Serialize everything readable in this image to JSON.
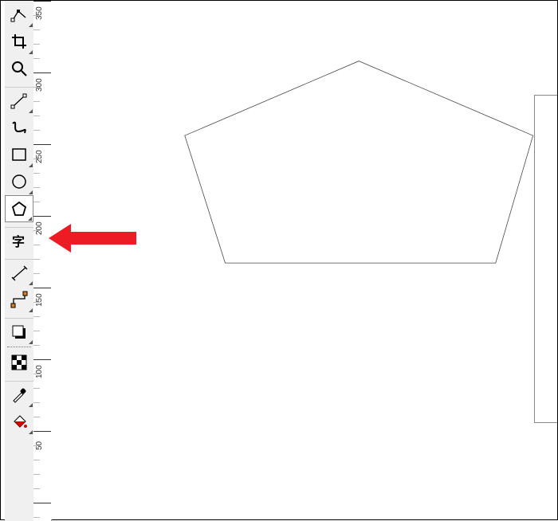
{
  "ruler": {
    "labels": [
      "350",
      "300",
      "250",
      "200",
      "150",
      "100",
      "50"
    ]
  },
  "tools": [
    {
      "name": "edit-nodes-tool",
      "flyout": true
    },
    {
      "name": "crop-tool",
      "flyout": true
    },
    {
      "name": "zoom-tool",
      "flyout": false
    },
    {
      "name": "freehand-tool",
      "flyout": true
    },
    {
      "name": "artistic-media-tool",
      "flyout": false
    },
    {
      "name": "rectangle-tool",
      "flyout": true
    },
    {
      "name": "ellipse-tool",
      "flyout": true
    },
    {
      "name": "polygon-tool",
      "flyout": true,
      "active": true
    },
    {
      "name": "text-tool",
      "flyout": false
    },
    {
      "name": "dimension-tool",
      "flyout": true
    },
    {
      "name": "connector-tool",
      "flyout": true
    },
    {
      "name": "drop-shadow-tool",
      "flyout": true
    },
    {
      "name": "transparency-tool",
      "flyout": false
    },
    {
      "name": "eyedropper-tool",
      "flyout": true
    },
    {
      "name": "fill-tool",
      "flyout": true
    }
  ],
  "highlight_tool_index": 7,
  "shape": {
    "type": "pentagon",
    "sides": 5
  }
}
